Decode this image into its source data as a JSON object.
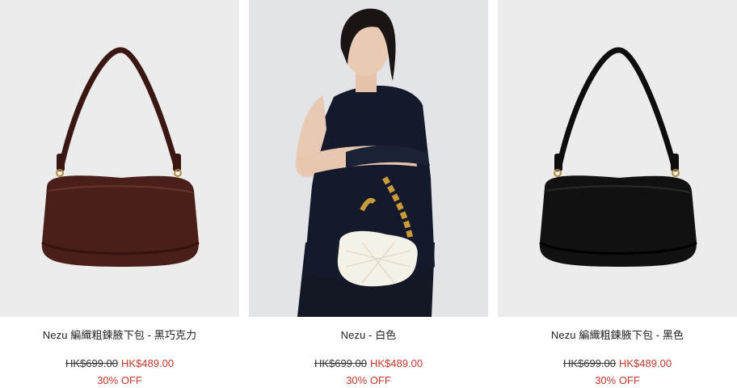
{
  "products": [
    {
      "name": "Nezu 編織粗鍊腋下包 - 黑巧克力",
      "original_price": "HK$699.00",
      "sale_price": "HK$489.00",
      "discount": "30% OFF",
      "image": "brown-shoulder-bag"
    },
    {
      "name": "Nezu - 白色",
      "original_price": "HK$699.00",
      "sale_price": "HK$489.00",
      "discount": "30% OFF",
      "image": "model-holding-white-bag"
    },
    {
      "name": "Nezu 編織粗鍊腋下包 - 黑色",
      "original_price": "HK$699.00",
      "sale_price": "HK$489.00",
      "discount": "30% OFF",
      "image": "black-shoulder-bag"
    }
  ],
  "colors": {
    "sale": "#c0392b",
    "bag_brown": "#4a1f1a",
    "bag_black": "#111111",
    "bag_white": "#f4f1e6",
    "photo_bg": "#ececec"
  }
}
